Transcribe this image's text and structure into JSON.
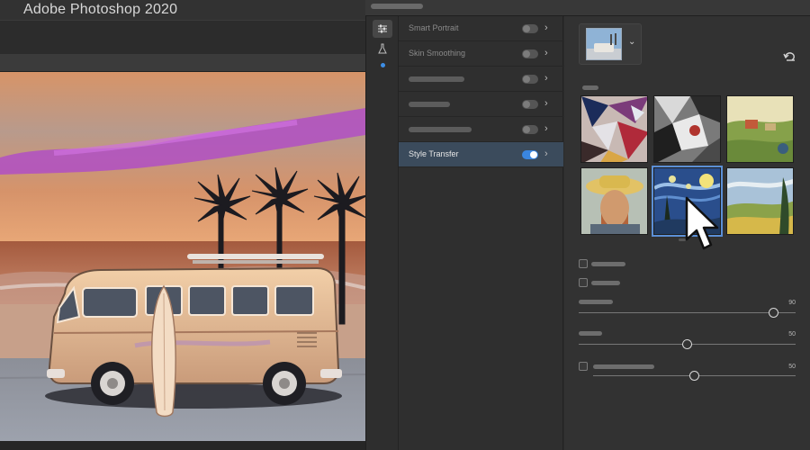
{
  "window": {
    "title": "Adobe Photoshop 2020"
  },
  "neural_filters": {
    "filters": [
      {
        "label": "Smart Portrait",
        "enabled": false,
        "active": false
      },
      {
        "label": "Skin Smoothing",
        "enabled": false,
        "active": false
      },
      {
        "label": "",
        "enabled": false,
        "active": false
      },
      {
        "label": "",
        "enabled": false,
        "active": false
      },
      {
        "label": "",
        "enabled": false,
        "active": false
      },
      {
        "label": "Style Transfer",
        "enabled": true,
        "active": true
      }
    ],
    "settings": {
      "styles": [
        {
          "name": "abstract-collage-style"
        },
        {
          "name": "cubist-portrait-style"
        },
        {
          "name": "impressionist-village-style"
        },
        {
          "name": "self-portrait-straw-hat-style"
        },
        {
          "name": "starry-night-style"
        },
        {
          "name": "wheat-field-cypress-style"
        }
      ],
      "selected_style": 4,
      "sliders": [
        {
          "value": "90",
          "level": 90
        },
        {
          "value": "50",
          "level": 50
        },
        {
          "value": "50",
          "level": 50
        }
      ]
    }
  },
  "colors": {
    "accent": "#3a86e0",
    "panel_bg": "#323232",
    "active_row": "#3b4b5c"
  }
}
